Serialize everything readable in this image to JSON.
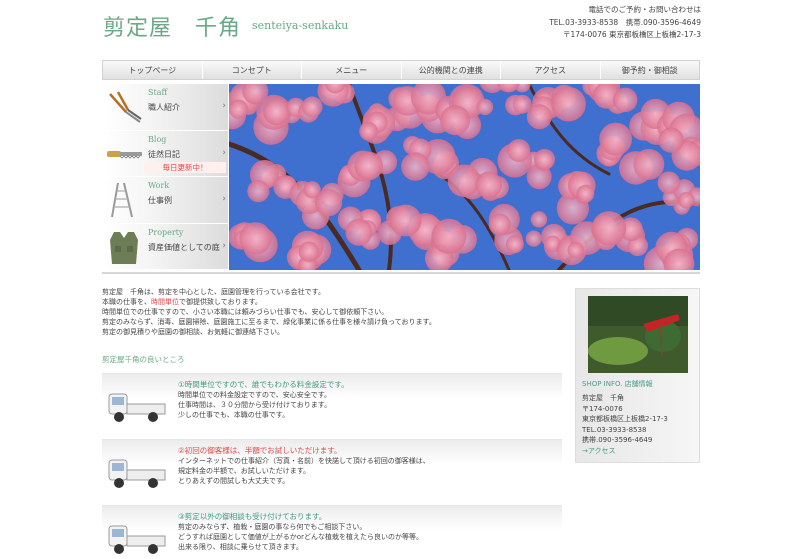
{
  "header": {
    "logo": "剪定屋　千角",
    "logo_sub": "senteiya-senkaku",
    "contact_lines": [
      "電話でのご予約・お問い合わせは",
      "TEL.03-3933-8538　携帯.090-3596-4649",
      "〒174-0076 東京都板橋区上板橋2-17-3"
    ]
  },
  "nav": [
    "トップページ",
    "コンセプト",
    "メニュー",
    "公的機関との連携",
    "アクセス",
    "御予約・御相談"
  ],
  "side_menu": [
    {
      "en": "Staff",
      "jp": "職人紹介",
      "icon": "shears-icon"
    },
    {
      "en": "Blog",
      "jp": "徒然日記",
      "icon": "saw-icon",
      "badge": "毎日更新中！"
    },
    {
      "en": "Work",
      "jp": "仕事例",
      "icon": "ladder-icon"
    },
    {
      "en": "Property",
      "jp": "資産価値としての庭",
      "icon": "vest-icon"
    }
  ],
  "intro": {
    "line1": "剪定屋　千角は、剪定を中心とした、庭園管理を行っている会社です。",
    "line2_pre": "本職の仕事を、",
    "line2_hl": "時間単位",
    "line2_post": "で御提供致しております。",
    "line3": "時間単位での仕事ですので、小さい本職には頼みづらい仕事でも、安心して御依頼下さい。",
    "line4": "剪定のみならず、消毒、庭園掃除、庭園施工に至るまで、緑化事業に係る仕事を様々請け負っております。",
    "line5": "剪定の御見積りや庭園の御相談、お気軽に御連絡下さい。"
  },
  "section_title": "剪定屋千角の良いところ",
  "features": [
    {
      "title": "①時間単位ですので、誰でもわかる料金設定です。",
      "lines": [
        "時間単位での料金設定ですので、安心安全です。",
        "仕事時間は、３０分間から受け付けております。",
        "少しの仕事でも、本職の仕事です。"
      ],
      "title_red": false
    },
    {
      "title": "②初回の御客様は、半額でお試しいただけます。",
      "lines": [
        "インターネットでの仕事紹介（写真・名前）を快諾して頂ける初回の御客様は、",
        "規定料金の半額で、お試しいただけます。",
        "とりあえずの間試しも大丈夫です。"
      ],
      "title_red": true
    },
    {
      "title": "③剪定以外の御相談も受け付けております。",
      "lines": [
        "剪定のみならず、植栽・庭園の事なら何でもご相談下さい。",
        "どうすれば庭園として価値が上がるかorどんな植栽を植えたら良いのか等等。",
        "出来る限り、相談に乗らせて頂きます。"
      ],
      "title_red": false
    }
  ],
  "shop": {
    "heading": "SHOP INFO. 店舗情報",
    "lines": [
      "剪定屋　千角",
      "〒174-0076",
      "東京都板橋区上板橋2-17-3",
      "TEL.03-3933-8538",
      "携帯.090-3596-4649"
    ],
    "access": "→アクセス"
  },
  "colors": {
    "accent": "#6aa886",
    "highlight": "#e04a4a",
    "sky": "#4f7fd6",
    "blossom": "#e58aa6"
  }
}
